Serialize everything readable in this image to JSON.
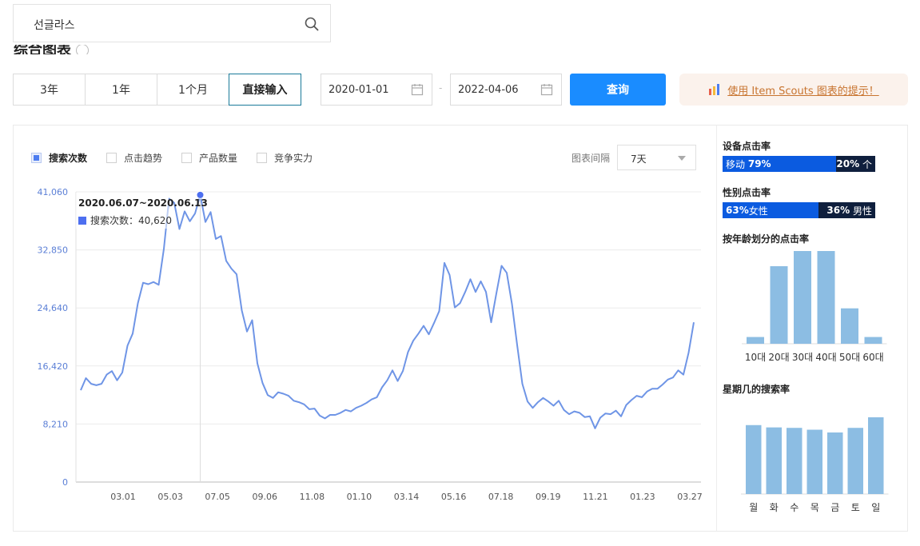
{
  "search": {
    "value": "선글라스"
  },
  "section_title": "综合图表",
  "periods": [
    {
      "label": "3年",
      "active": false
    },
    {
      "label": "1年",
      "active": false
    },
    {
      "label": "1个月",
      "active": false
    },
    {
      "label": "直接输入",
      "active": true
    }
  ],
  "date_from": "2020-01-01",
  "date_separator": "-",
  "date_to": "2022-04-06",
  "query_label": "查询",
  "tips_label": "使用 Item Scouts 图表的提示！",
  "legend": [
    {
      "label": "搜索次数",
      "checked": true
    },
    {
      "label": "点击趋势",
      "checked": false
    },
    {
      "label": "产品数量",
      "checked": false
    },
    {
      "label": "竞争实力",
      "checked": false
    }
  ],
  "interval": {
    "label": "图表间隔",
    "value": "7天"
  },
  "tooltip": {
    "title": "2020.06.07~2020.06.13",
    "series": "搜索次数",
    "value_text": "40,620"
  },
  "right_panel": {
    "device": {
      "title": "设备点击率",
      "mobile_label": "移动",
      "mobile_pct": "79%",
      "mobile_value": 79,
      "pc_pct": "20%",
      "pc_label": "个"
    },
    "gender": {
      "title": "性别点击率",
      "female_pct": "63%",
      "female_label": "女性",
      "female_value": 63,
      "male_pct": "36%",
      "male_label": "男性"
    },
    "age_title": "按年龄划分的点击率",
    "weekday_title": "星期几的搜索率"
  },
  "colors": {
    "line": "#6f95e6",
    "accent": "#1a8cff",
    "bar": "#8cbde3",
    "mobile": "#0b5be0",
    "dark": "#0f1f3d"
  },
  "chart_data": [
    {
      "type": "line",
      "series_name": "搜索次数",
      "y_ticks": [
        "41,060",
        "32,850",
        "24,640",
        "16,420",
        "8,210",
        "0"
      ],
      "ylim": [
        0,
        41060
      ],
      "x_ticks": [
        "03.01",
        "05.03",
        "07.05",
        "09.06",
        "11.08",
        "01.10",
        "03.14",
        "05.16",
        "07.18",
        "09.19",
        "11.21",
        "01.23",
        "03.27"
      ],
      "values": [
        13000,
        14700,
        13900,
        13700,
        13900,
        15200,
        15700,
        14400,
        15500,
        19300,
        21000,
        25300,
        28200,
        28000,
        28300,
        27900,
        33000,
        40100,
        39500,
        35800,
        38300,
        36900,
        38000,
        40620,
        36800,
        38200,
        34400,
        34800,
        31300,
        30200,
        29400,
        24300,
        21300,
        22900,
        16800,
        14000,
        12300,
        11900,
        12700,
        12500,
        12200,
        11500,
        11300,
        11000,
        10300,
        10400,
        9400,
        9000,
        9500,
        9500,
        9800,
        10200,
        10000,
        10500,
        10800,
        11200,
        11700,
        12000,
        13400,
        14400,
        15800,
        14300,
        15700,
        18400,
        20000,
        21000,
        22100,
        20900,
        22500,
        24200,
        31000,
        29300,
        24700,
        25300,
        26900,
        28700,
        26900,
        28400,
        26900,
        22600,
        26700,
        30600,
        29600,
        25200,
        19400,
        13900,
        11400,
        10500,
        11300,
        11900,
        11400,
        10800,
        11500,
        10200,
        9600,
        10000,
        9800,
        9200,
        9300,
        7600,
        9100,
        9700,
        9600,
        10100,
        9300,
        10900,
        11600,
        12200,
        12000,
        12800,
        13200,
        13200,
        13800,
        14500,
        14800,
        15800,
        15200,
        18300,
        22600
      ],
      "tooltip_index": 23
    },
    {
      "type": "bar",
      "title": "按年龄划分的点击率",
      "categories": [
        "10대",
        "20대",
        "30대",
        "40대",
        "50대",
        "60대"
      ],
      "values": [
        4,
        46,
        55,
        55,
        21,
        4
      ]
    },
    {
      "type": "bar",
      "title": "星期几的搜索率",
      "categories": [
        "월",
        "화",
        "수",
        "목",
        "금",
        "토",
        "일"
      ],
      "values": [
        15,
        14.5,
        14.4,
        14,
        13.4,
        14.4,
        16.7
      ]
    }
  ]
}
